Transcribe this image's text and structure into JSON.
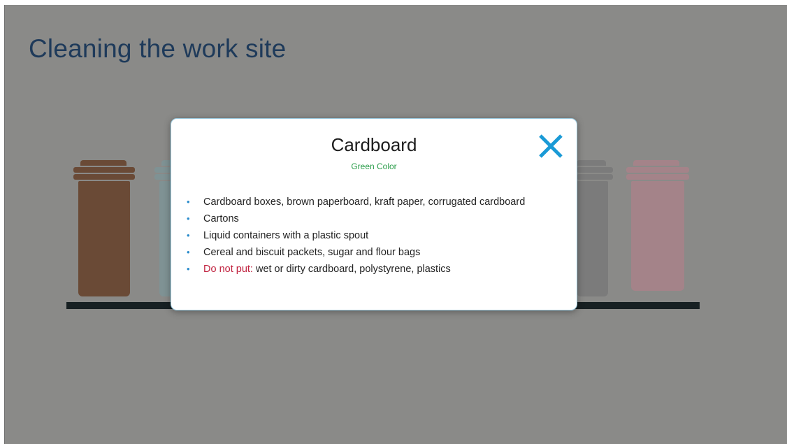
{
  "page": {
    "title": "Cleaning the work site"
  },
  "bins": [
    {
      "name": "brown",
      "color": "#6a4a36"
    },
    {
      "name": "teal",
      "color": "#7f9294"
    },
    {
      "name": "gray",
      "color": "#7b7b7b"
    },
    {
      "name": "pink",
      "color": "#a48389"
    }
  ],
  "dialog": {
    "title": "Cardboard",
    "subtitle": "Green Color",
    "close_icon": "close-x-icon",
    "accent": "#1a9ad6",
    "items": [
      {
        "text": "Cardboard boxes, brown paperboard, kraft paper, corrugated cardboard"
      },
      {
        "text": "Cartons"
      },
      {
        "text": "Liquid containers with a plastic spout"
      },
      {
        "text": "Cereal and biscuit packets, sugar and flour bags"
      }
    ],
    "warning": {
      "label": "Do not put:",
      "text": " wet or dirty cardboard, polystyrene, plastics"
    }
  },
  "colors": {
    "overlay": "#8a8a88",
    "title": "#1e3a5a",
    "subtitle": "#2a9d4a",
    "bullet": "#2a8ccc",
    "warning": "#c0213e"
  }
}
